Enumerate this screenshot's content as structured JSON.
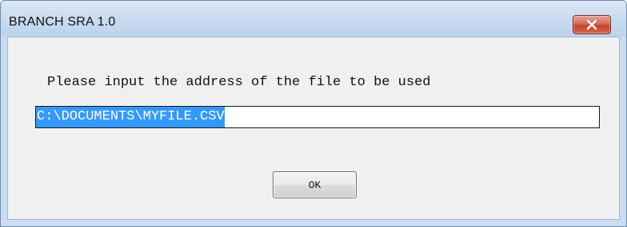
{
  "window": {
    "title": "BRANCH SRA 1.0",
    "close_icon": "close-x-icon",
    "close_color": "#c7432d"
  },
  "dialog": {
    "prompt": "Please input the address of the file to be used",
    "input_value": "C:\\DOCUMENTS\\MYFILE.CSV",
    "selection_color": "#3399ff",
    "ok_label": "OK"
  }
}
